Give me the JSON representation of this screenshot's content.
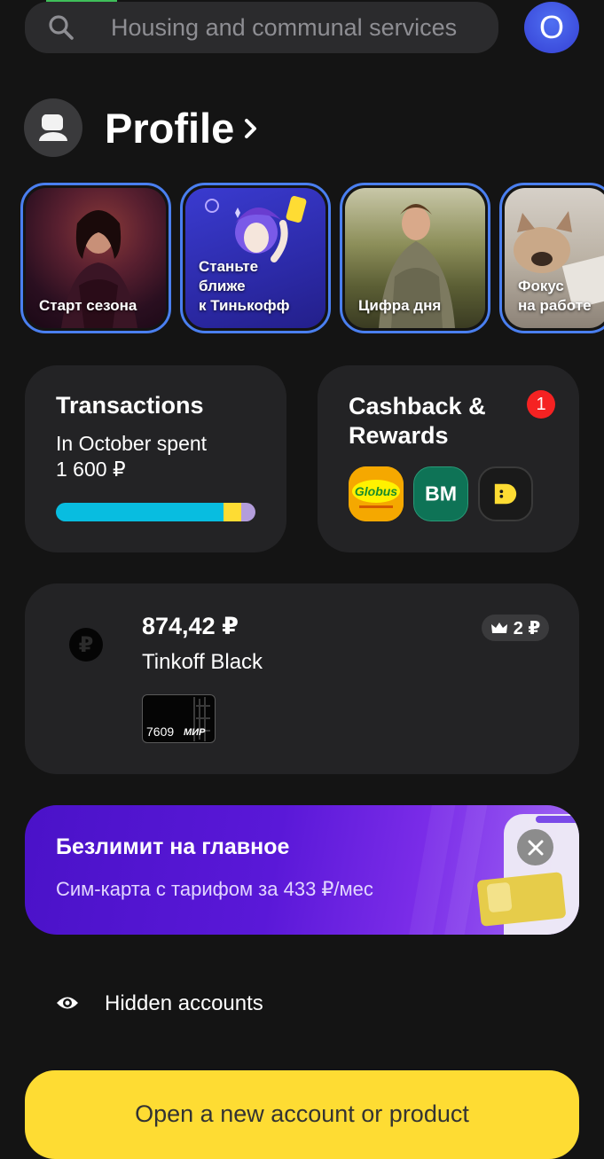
{
  "search": {
    "placeholder": "Housing and communal services"
  },
  "user_avatar": {
    "letter": "O",
    "color": "#3f4de0"
  },
  "profile": {
    "title": "Profile"
  },
  "stories": [
    {
      "label": "Старт сезона"
    },
    {
      "label_line1": "Станьте",
      "label_line2": "ближе",
      "label_line3": "к Тинькофф"
    },
    {
      "label": "Цифра дня"
    },
    {
      "label_line1": "Фокус",
      "label_line2": "на работе"
    }
  ],
  "transactions": {
    "title": "Transactions",
    "subtitle_line1": "In October spent",
    "amount": "1 600 ₽",
    "bar_segments": [
      {
        "fraction": 0.84,
        "color": "#08bde0"
      },
      {
        "fraction": 0.09,
        "color": "#fedc33"
      },
      {
        "fraction": 0.07,
        "color": "#b39ddb"
      }
    ]
  },
  "cashback": {
    "title_line1": "Cashback &",
    "title_line2": "Rewards",
    "badge_count": "1",
    "partners": [
      {
        "name": "globus",
        "text": "Globus",
        "icon": "globus-logo"
      },
      {
        "name": "vm",
        "text": "BM",
        "icon": "vm-logo"
      },
      {
        "name": "d",
        "icon": "d-logo"
      }
    ]
  },
  "account": {
    "amount": "874,42 ₽",
    "name": "Tinkoff Black",
    "cashback": "2 ₽",
    "card_number": "7609",
    "card_system": "МИР"
  },
  "promo": {
    "title": "Безлимит на главное",
    "subtitle": "Сим-карта с тарифом за 433 ₽/мес"
  },
  "hidden_accounts": {
    "label": "Hidden accounts"
  },
  "open_button": {
    "label": "Open a new account or product"
  },
  "colors": {
    "background": "#141414",
    "card": "#232325",
    "accent_yellow": "#fedc33",
    "story_border": "#4a7ff0",
    "badge_red": "#f52222"
  }
}
